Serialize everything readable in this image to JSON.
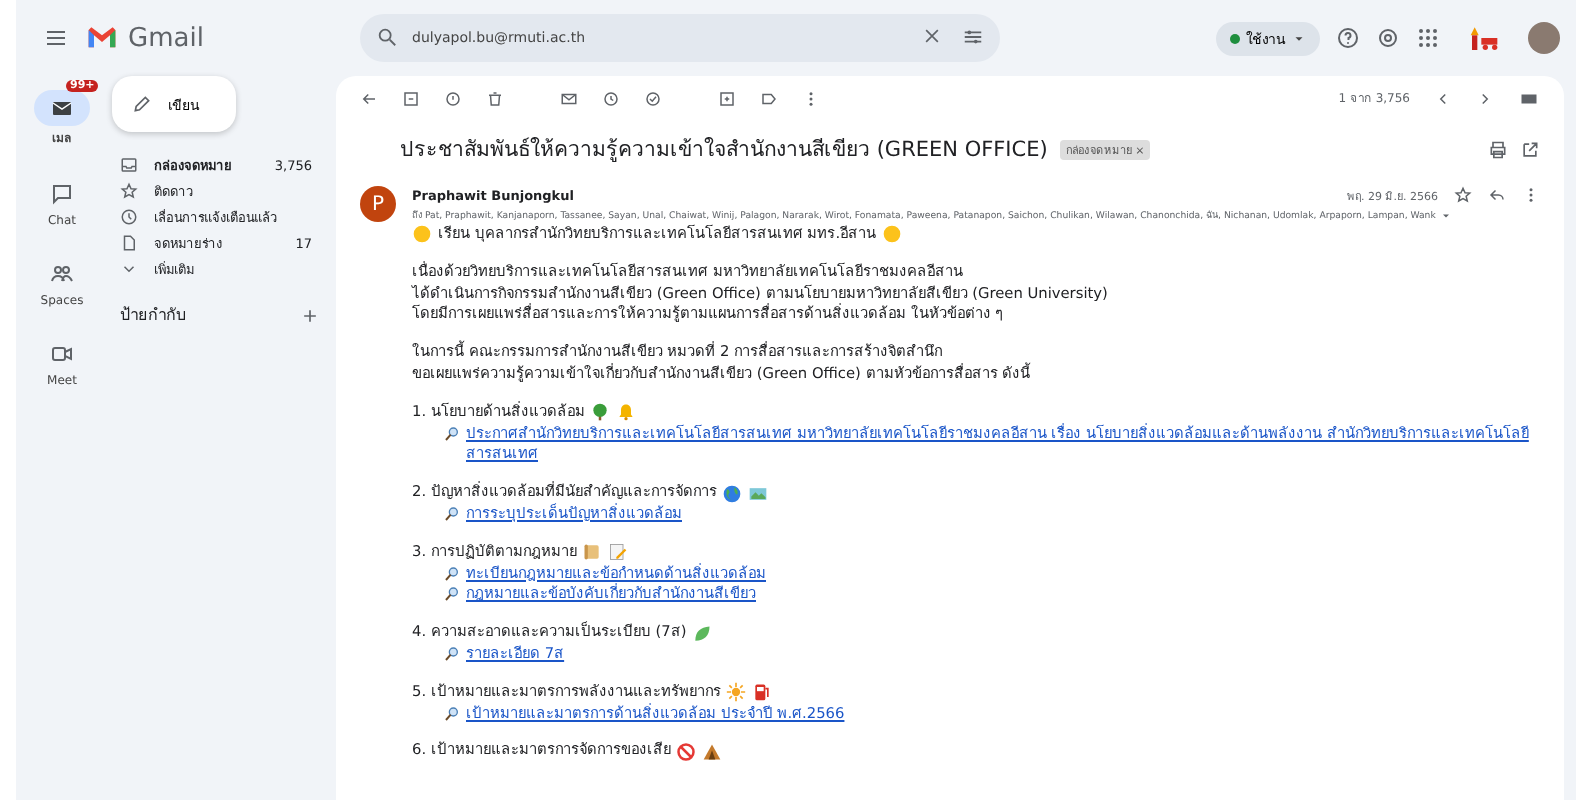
{
  "app_name": "Gmail",
  "search": {
    "value": "dulyapol.bu@rmuti.ac.th"
  },
  "status": {
    "label": "ใช้งาน"
  },
  "rail": [
    {
      "label": "เมล",
      "badge": "99+",
      "selected": true
    },
    {
      "label": "Chat",
      "selected": false
    },
    {
      "label": "Spaces",
      "selected": false
    },
    {
      "label": "Meet",
      "selected": false
    }
  ],
  "compose": "เขียน",
  "folders": [
    {
      "label": "กล่องจดหมาย",
      "count": "3,756",
      "selected": false
    },
    {
      "label": "ติดดาว",
      "selected": false
    },
    {
      "label": "เลื่อนการแจ้งเตือนแล้ว",
      "selected": false
    },
    {
      "label": "จดหมายร่าง",
      "count": "17",
      "selected": false
    },
    {
      "label": "เพิ่มเติม",
      "selected": false
    }
  ],
  "labels_heading": "ป้ายกำกับ",
  "pagination": "1 จาก 3,756",
  "mail": {
    "subject": "ประชาสัมพันธ์ให้ความรู้ความเข้าใจสำนักงานสีเขียว (GREEN OFFICE)",
    "tag": "กล่องจดหมาย ×",
    "avatar": "P",
    "sender": "Praphawit Bunjongkul",
    "recipients": "ถึง Pat, Praphawit, Kanjanaporn, Tassanee, Sayan, Unal, Chaiwat, Winij, Palagon, Nararak, Wirot, Fonamata, Paweena, Patanapon, Saichon, Chulikan, Wilawan, Chanonchida, ฉัน, Nichanan, Udomlak, Arpaporn, Lampan, Wank",
    "date": "พฤ. 29 มิ.ย. 2566",
    "greeting": "เรียน บุคลากรสำนักวิทยบริการและเทคโนโลยีสารสนเทศ มทร.อีสาน",
    "paragraphs": [
      [
        "เนื่องด้วยวิทยบริการและเทคโนโลยีสารสนเทศ มหาวิทยาลัยเทคโนโลยีราชมงคลอีสาน",
        "ได้ดำเนินการกิจกรรมสำนักงานสีเขียว (Green Office)  ตามนโยบายมหาวิทยาลัยสีเขียว (Green University)",
        "โดยมีการเผยแพร่สื่อสารและการให้ความรู้ตามแผนการสื่อสารด้านสิ่งแวดล้อม ในหัวข้อต่าง ๆ"
      ],
      [
        "ในการนี้ คณะกรรมการสำนักงานสีเขียว หมวดที่ 2 การสื่อสารและการสร้างจิตสำนึก",
        "ขอเผยแพร่ความรู้ความเข้าใจเกี่ยวกับสำนักงานสีเขียว (Green Office) ตามหัวข้อการสื่อสาร ดังนี้"
      ]
    ],
    "sections": [
      {
        "title": "1. นโยบายด้านสิ่งแวดล้อม",
        "links": [
          "ประกาศสำนักวิทยบริการและเทคโนโลยีสารสนเทศ มหาวิทยาลัยเทคโนโลยีราชมงคลอีสาน เรื่อง นโยบายสิ่งแวดล้อมและด้านพลังงาน สำนักวิทยบริการและเทคโนโลยีสารสนเทศ"
        ]
      },
      {
        "title": "2. ปัญหาสิ่งแวดล้อมที่มีนัยสำคัญและการจัดการ",
        "links": [
          "การระบุประเด็นปัญหาสิ่งแวดล้อม"
        ]
      },
      {
        "title": "3. การปฏิบัติตามกฎหมาย",
        "links": [
          "ทะเบียนกฎหมายและข้อกำหนดด้านสิ่งแวดล้อม",
          "กฎหมายและข้อบังคับเกี่ยวกับสำนักงานสีเขียว"
        ]
      },
      {
        "title": "4. ความสะอาดและความเป็นระเบียบ (7ส)",
        "links": [
          "รายละเอียด 7ส"
        ]
      },
      {
        "title": "5. เป้าหมายและมาตรการพลังงานและทรัพยากร",
        "links": [
          "เป้าหมายและมาตรการด้านสิ่งแวดล้อม ประจำปี พ.ศ.2566"
        ]
      },
      {
        "title": "6. เป้าหมายและมาตรการจัดการของเสีย"
      }
    ]
  }
}
